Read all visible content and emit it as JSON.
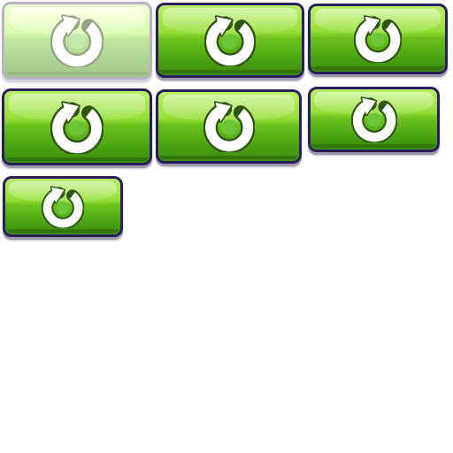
{
  "sprite_sheet": {
    "background_color": "#ffffff",
    "button_border_color": "#2a1f5c",
    "button_gradient_colors": [
      "#b9f06a",
      "#98df3a",
      "#6cc21c",
      "#4aa312",
      "#3a8a0c"
    ],
    "buttons": [
      {
        "icon": "restart-icon",
        "state": "disabled"
      },
      {
        "icon": "restart-icon",
        "state": "normal"
      },
      {
        "icon": "restart-icon",
        "state": "normal"
      },
      {
        "icon": "restart-icon",
        "state": "normal"
      },
      {
        "icon": "restart-icon",
        "state": "normal"
      },
      {
        "icon": "restart-icon",
        "state": "normal"
      },
      {
        "icon": "restart-icon",
        "state": "normal"
      }
    ]
  }
}
